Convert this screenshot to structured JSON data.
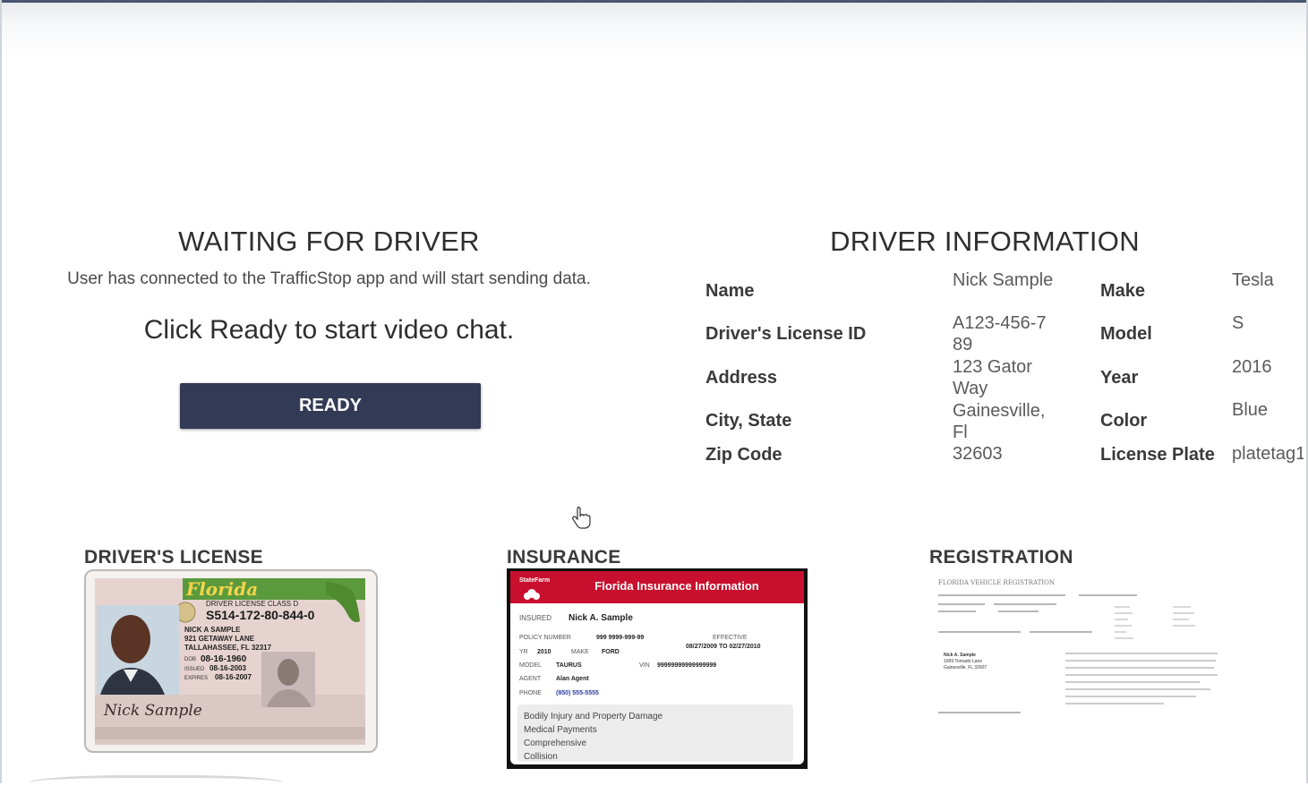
{
  "waiting": {
    "title": "WAITING FOR DRIVER",
    "subtitle": "User has connected to the TrafficStop app and will start sending data.",
    "cta": "Click Ready to start video chat.",
    "ready_label": "READY"
  },
  "driver_info": {
    "title": "DRIVER INFORMATION",
    "fields": [
      {
        "label": "Name",
        "value": "Nick Sample"
      },
      {
        "label": "Driver's License ID",
        "value": "A123-456-789"
      },
      {
        "label": "Address",
        "value": "123 Gator Way"
      },
      {
        "label": "City, State",
        "value": "Gainesville, Fl"
      },
      {
        "label": "Zip Code",
        "value": "32603"
      }
    ],
    "vehicle": [
      {
        "label": "Make",
        "value": "Tesla"
      },
      {
        "label": "Model",
        "value": "S"
      },
      {
        "label": "Year",
        "value": "2016"
      },
      {
        "label": "Color",
        "value": "Blue"
      },
      {
        "label": "License Plate",
        "value": "platetag1"
      }
    ]
  },
  "documents": {
    "license": {
      "label": "DRIVER'S LICENSE",
      "state": "Florida",
      "class": "DRIVER LICENSE  CLASS D",
      "number": "S514-172-80-844-0",
      "name": "NICK A SAMPLE",
      "street": "921 GETAWAY LANE",
      "city": "TALLAHASSEE, FL 32317",
      "dob": "08-16-1960",
      "issued": "08-16-2003",
      "expires": "08-16-2007",
      "signature": "Nick Sample"
    },
    "insurance": {
      "label": "INSURANCE",
      "brand": "StateFarm",
      "header": "Florida Insurance Information",
      "insured": "Nick A. Sample",
      "policy": "999 9999-999-99",
      "effective": "08/27/2009 TO 02/27/2010",
      "yr": "2010",
      "make": "FORD",
      "model": "TAURUS",
      "vin": "99999999999999999",
      "agent": "Alan Agent",
      "phone": "(850) 555-5555",
      "coverage": [
        "Bodily Injury and Property Damage",
        "Medical Payments",
        "Comprehensive",
        "Collision"
      ]
    },
    "registration": {
      "label": "REGISTRATION",
      "heading": "FLORIDA VEHICLE REGISTRATION",
      "owner": "Nick A. Sample",
      "street": "1999 Tornado Lane",
      "city": "Gainesville, FL 32607"
    }
  }
}
